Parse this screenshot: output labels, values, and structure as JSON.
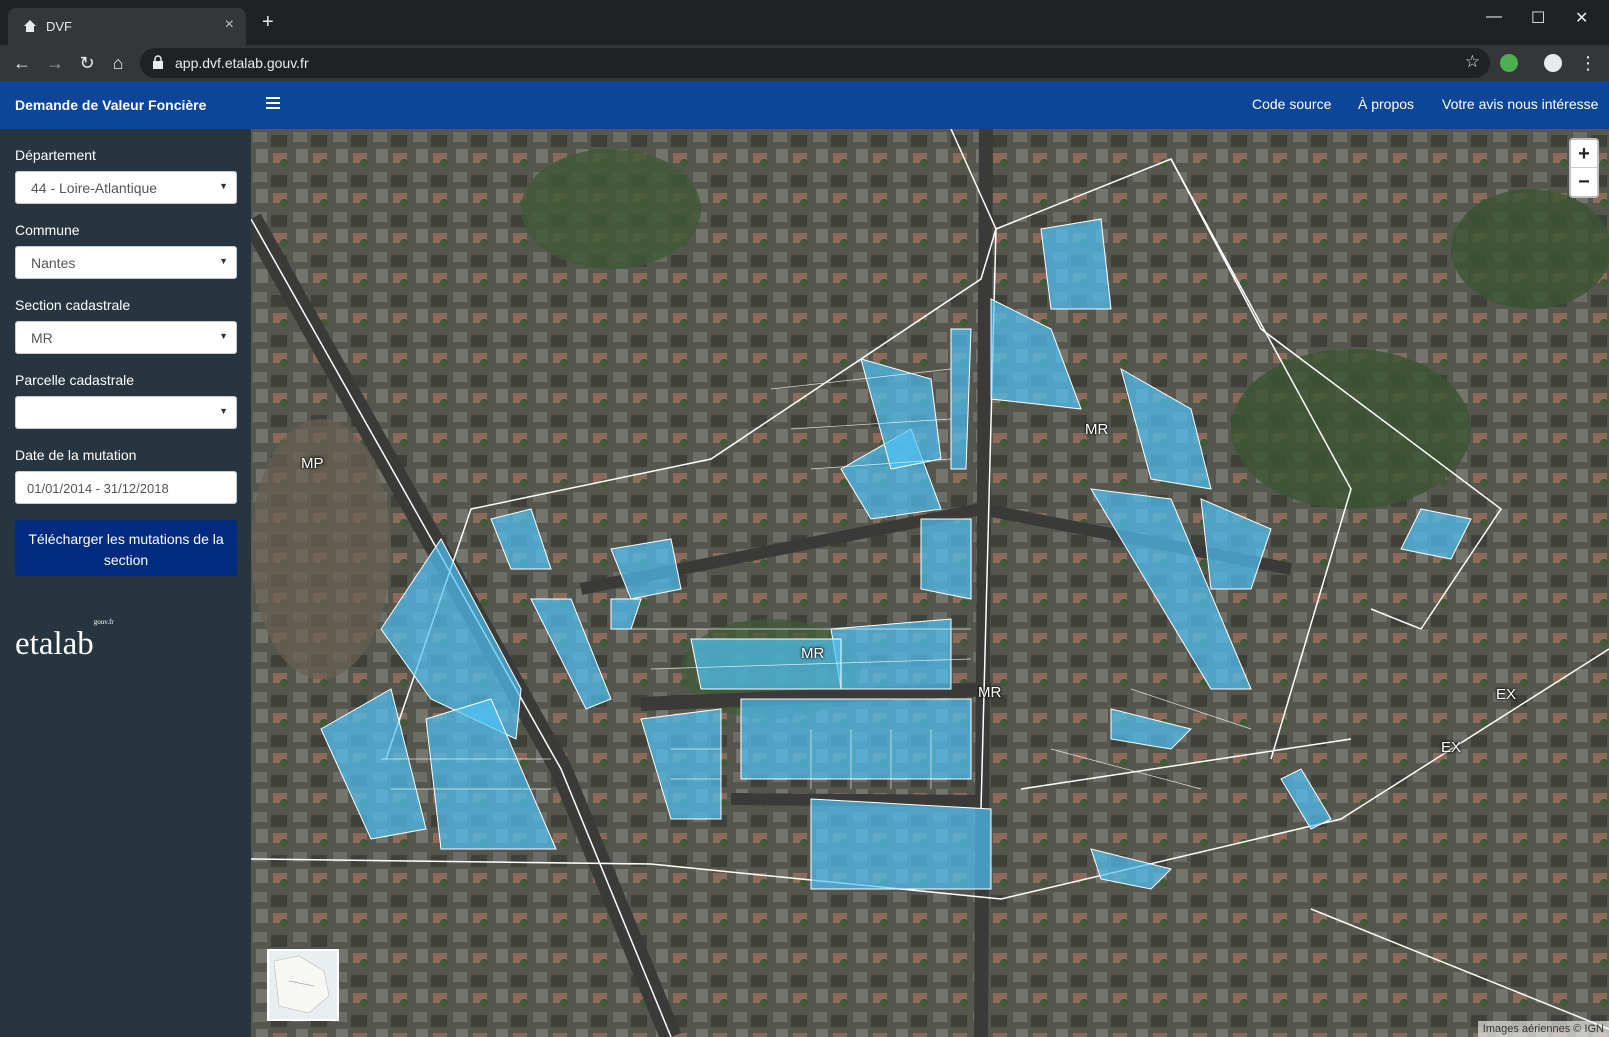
{
  "browser": {
    "tab_title": "DVF",
    "tab_close": "×",
    "new_tab": "+",
    "minimize": "—",
    "maximize": "☐",
    "close": "✕",
    "url": "app.dvf.etalab.gouv.fr"
  },
  "app": {
    "brand": "Demande de Valeur Foncière",
    "nav": [
      "Code source",
      "À propos",
      "Votre avis nous intéresse"
    ]
  },
  "filters": {
    "departement_label": "Département",
    "departement_value": "44 - Loire-Atlantique",
    "commune_label": "Commune",
    "commune_value": "Nantes",
    "section_label": "Section cadastrale",
    "section_value": "MR",
    "parcelle_label": "Parcelle cadastrale",
    "parcelle_value": "",
    "date_label": "Date de la mutation",
    "date_value": "01/01/2014 - 31/12/2018",
    "download_button": "Télécharger les mutations de la section"
  },
  "logo": {
    "text": "etalab",
    "suffix": "gouv.fr"
  },
  "map": {
    "zoom_in": "+",
    "zoom_out": "−",
    "attribution": "Images aériennes © IGN",
    "section_labels": [
      "MP",
      "MR",
      "MR",
      "MR",
      "EX",
      "EX"
    ]
  },
  "colors": {
    "brand_blue": "#0d4599",
    "sidebar": "#26353f",
    "button": "#002b7f",
    "parcel_fill": "#4fc3f7"
  }
}
